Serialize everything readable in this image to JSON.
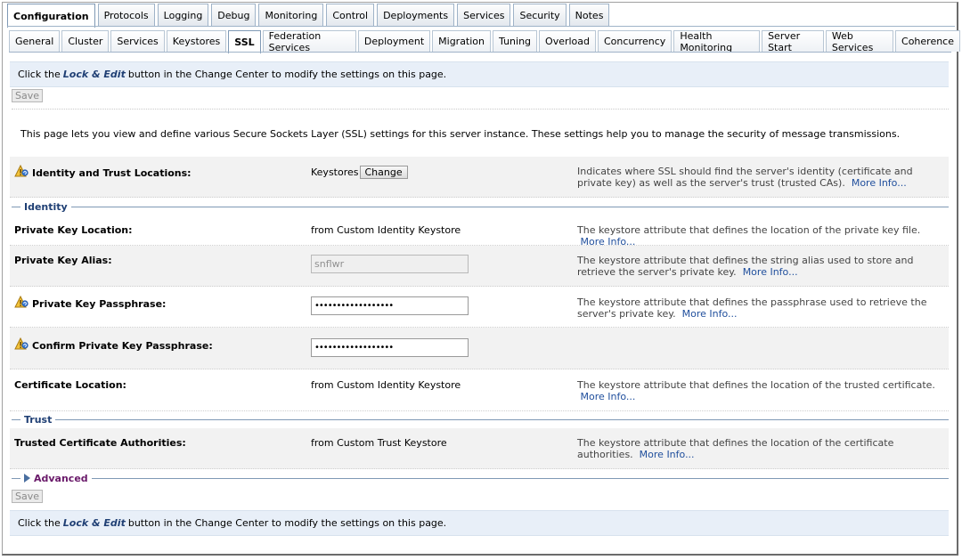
{
  "tabs_primary": [
    "Configuration",
    "Protocols",
    "Logging",
    "Debug",
    "Monitoring",
    "Control",
    "Deployments",
    "Services",
    "Security",
    "Notes"
  ],
  "tabs_secondary": [
    "General",
    "Cluster",
    "Services",
    "Keystores",
    "SSL",
    "Federation Services",
    "Deployment",
    "Migration",
    "Tuning",
    "Overload",
    "Concurrency",
    "Health Monitoring",
    "Server Start",
    "Web Services",
    "Coherence"
  ],
  "notice": {
    "prefix": "Click the",
    "emph": "Lock & Edit",
    "suffix": "button in the Change Center to modify the settings on this page."
  },
  "save_label": "Save",
  "intro": "This page lets you view and define various Secure Sockets Layer (SSL) settings for this server instance. These settings help you to manage the security of message transmissions.",
  "more_info": "More Info...",
  "identity_trust": {
    "label": "Identity and Trust Locations:",
    "value": "Keystores",
    "button": "Change",
    "desc": "Indicates where SSL should find the server's identity (certificate and private key) as well as the server's trust (trusted CAs)."
  },
  "sections": {
    "identity": "Identity",
    "trust": "Trust",
    "advanced": "Advanced"
  },
  "private_key_location": {
    "label": "Private Key Location:",
    "value": "from Custom Identity Keystore",
    "desc": "The keystore attribute that defines the location of the private key file."
  },
  "private_key_alias": {
    "label": "Private Key Alias:",
    "value": "snflwr",
    "desc": "The keystore attribute that defines the string alias used to store and retrieve the server's private key."
  },
  "private_key_passphrase": {
    "label": "Private Key Passphrase:",
    "value": "••••••••••••••••••",
    "desc": "The keystore attribute that defines the passphrase used to retrieve the server's private key."
  },
  "confirm_passphrase": {
    "label": "Confirm Private Key Passphrase:",
    "value": "••••••••••••••••••"
  },
  "certificate_location": {
    "label": "Certificate Location:",
    "value": "from Custom Identity Keystore",
    "desc": "The keystore attribute that defines the location of the trusted certificate."
  },
  "trusted_ca": {
    "label": "Trusted Certificate Authorities:",
    "value": "from Custom Trust Keystore",
    "desc": "The keystore attribute that defines the location of the certificate authorities."
  },
  "colors": {
    "link": "#1f4e9c",
    "section": "#1f3f74",
    "advanced": "#6a1a6a",
    "notice_bg": "#e8eff8"
  },
  "icons": {
    "restart": "restart-required-icon",
    "expand": "expand-triangle-icon"
  }
}
